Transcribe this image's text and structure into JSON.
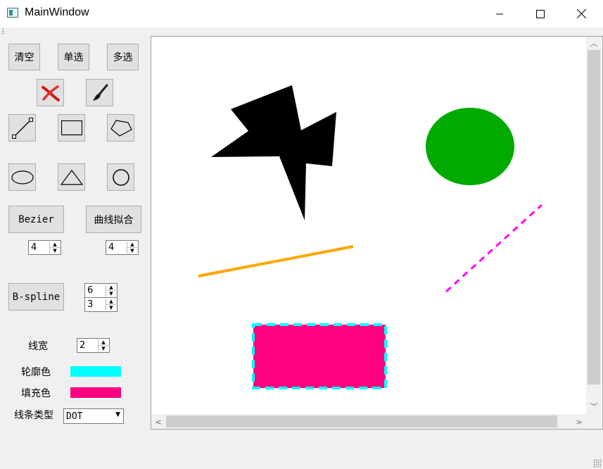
{
  "window": {
    "title": "MainWindow",
    "minimize_icon": "minimize-icon",
    "maximize_icon": "maximize-icon",
    "close_icon": "close-icon"
  },
  "toolbox": {
    "clear_label": "清空",
    "single_select_label": "单选",
    "multi_select_label": "多选",
    "bezier_label": "Bezier",
    "curve_fit_label": "曲线拟合",
    "bspline_label": "B-spline",
    "bezier_count": "4",
    "curve_fit_count": "4",
    "bspline_count": "6",
    "bspline_degree": "3",
    "line_width_label": "线宽",
    "line_width_value": "2",
    "outline_color_label": "轮廓色",
    "outline_color": "#00ffff",
    "fill_color_label": "填充色",
    "fill_color": "#ff0080",
    "line_type_label": "线条类型",
    "line_type_value": "DOT"
  },
  "canvas": {
    "shapes": [
      {
        "type": "polygon",
        "fill": "#000000"
      },
      {
        "type": "ellipse",
        "fill": "#00aa00"
      },
      {
        "type": "line",
        "stroke": "#ffa500",
        "style": "solid"
      },
      {
        "type": "line",
        "stroke": "#ff00ff",
        "style": "dash"
      },
      {
        "type": "rectangle",
        "fill": "#ff0080",
        "stroke": "#00ffff",
        "style": "dash"
      }
    ]
  }
}
